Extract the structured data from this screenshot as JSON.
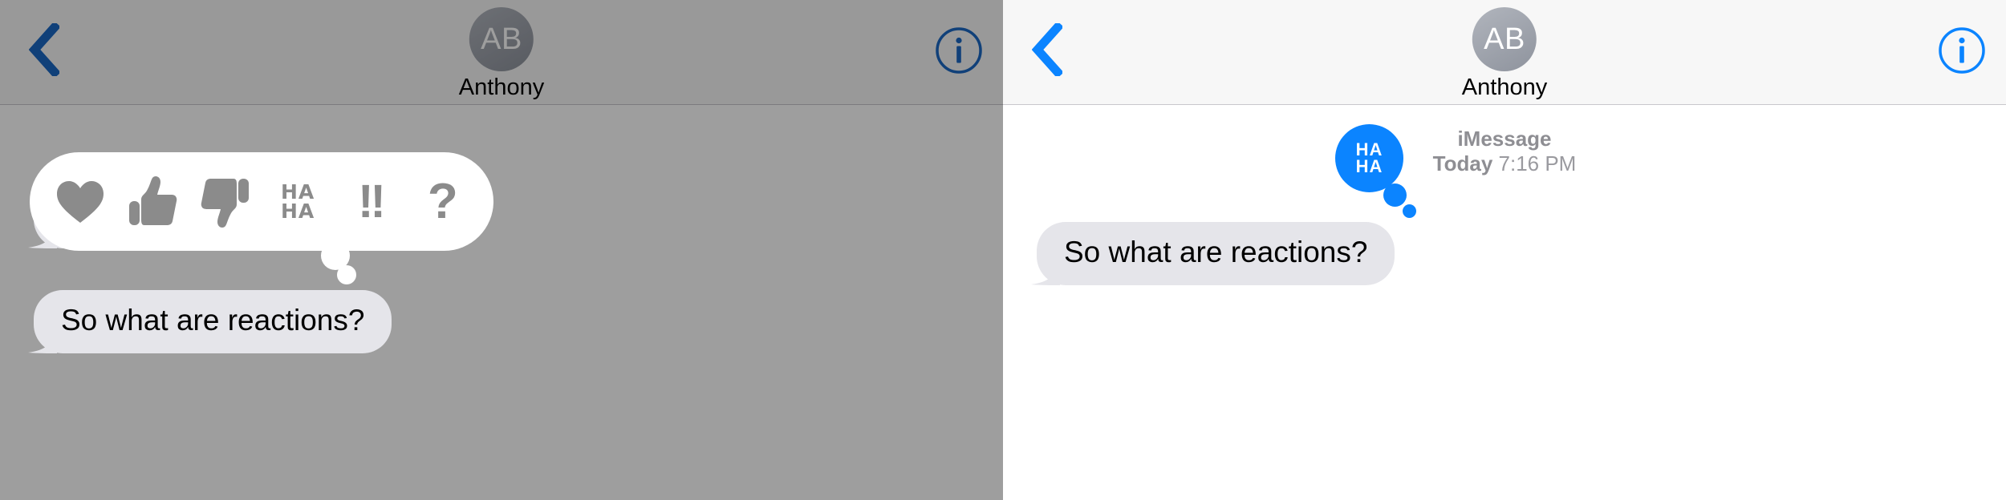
{
  "accent_color": "#0b84ff",
  "bubble_gray": "#e5e5ea",
  "panels": [
    {
      "id": "left",
      "state": "reaction-picker-open",
      "nav": {
        "back_label": "back-chevron",
        "info_label": "info",
        "avatar_initials": "AB",
        "contact_name": "Anthony"
      },
      "message": {
        "text": "So what are reactions?",
        "side": "incoming"
      },
      "reaction_picker": {
        "options": [
          {
            "id": "heart",
            "label": "Love",
            "glyph": "heart"
          },
          {
            "id": "thumbsup",
            "label": "Like",
            "glyph": "thumbs-up"
          },
          {
            "id": "thumbsdown",
            "label": "Dislike",
            "glyph": "thumbs-down"
          },
          {
            "id": "haha",
            "label": "Laugh",
            "glyph": "HA HA",
            "line1": "HA",
            "line2": "HA"
          },
          {
            "id": "exclamation",
            "label": "Emphasize",
            "glyph": "!!"
          },
          {
            "id": "question",
            "label": "Question",
            "glyph": "?"
          }
        ]
      }
    },
    {
      "id": "right",
      "state": "reaction-applied",
      "nav": {
        "back_label": "back-chevron",
        "info_label": "info",
        "avatar_initials": "AB",
        "contact_name": "Anthony"
      },
      "timestamp": {
        "service": "iMessage",
        "day": "Today",
        "time": "7:16 PM"
      },
      "message": {
        "text": "So what are reactions?",
        "side": "incoming"
      },
      "applied_reaction": {
        "id": "haha",
        "label": "Laugh",
        "line1": "HA",
        "line2": "HA",
        "color": "#0b84ff"
      }
    }
  ]
}
